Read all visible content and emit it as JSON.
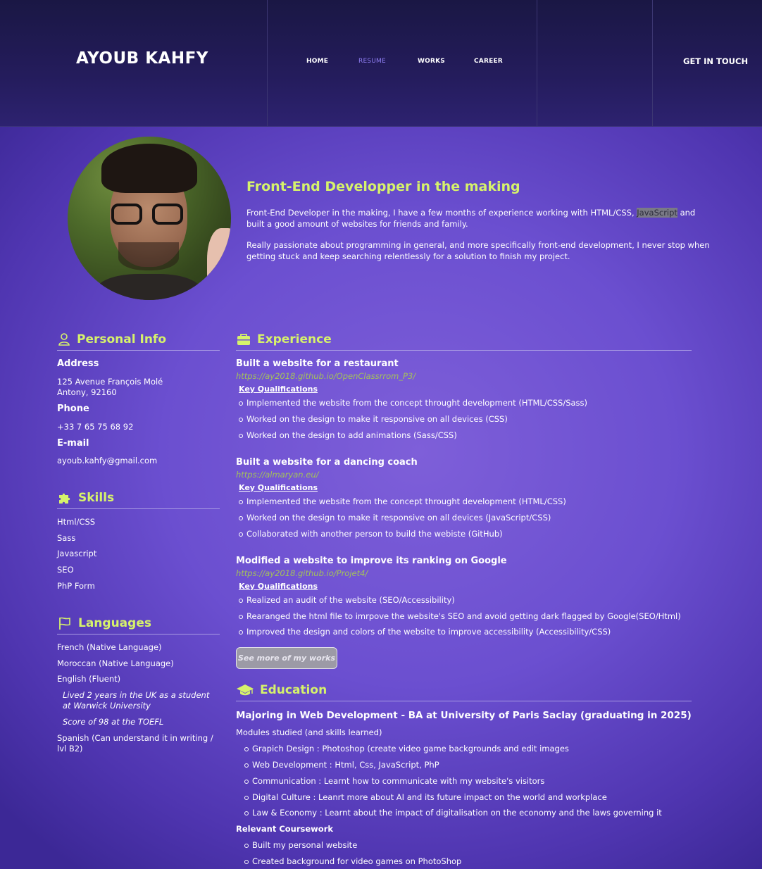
{
  "header": {
    "logo": "AYOUB KAHFY",
    "nav": [
      "HOME",
      "RESUME",
      "WORKS",
      "CAREER"
    ],
    "active_nav": "RESUME",
    "cta": "GET IN TOUCH"
  },
  "hero": {
    "title": "Front-End Developper in the making",
    "p1_before": "Front-End Developer in the making, I have a few months of experience working with HTML/CSS, ",
    "p1_highlight": "JavaScript",
    "p1_after": " and built a good amount of websites for friends and family.",
    "p2": "Really passionate about programming in general, and more specifically front-end development, I never stop when getting stuck and keep searching relentlessly for a solution to finish my project."
  },
  "personal_info": {
    "title": "Personal Info",
    "address_label": "Address",
    "address_line1": "125 Avenue François Molé",
    "address_line2": "Antony, 92160",
    "phone_label": "Phone",
    "phone": "+33 7 65 75 68 92",
    "email_label": "E-mail",
    "email": "ayoub.kahfy@gmail.com"
  },
  "skills": {
    "title": "Skills",
    "items": [
      "Html/CSS",
      "Sass",
      "Javascript",
      "SEO",
      "PhP Form"
    ]
  },
  "languages": {
    "title": "Languages",
    "items": [
      "French (Native Language)",
      "Moroccan (Native Language)",
      "English (Fluent)"
    ],
    "notes": [
      "Lived 2 years in the UK as a student at Warwick University",
      "Score of 98 at the TOEFL"
    ],
    "spanish": "Spanish (Can understand it in writing / lvl B2)"
  },
  "experience": {
    "title": "Experience",
    "key_label": "Key Qualifications",
    "jobs": [
      {
        "title": "Built a website for a restaurant",
        "link": "https://ay2018.github.io/OpenClassrrom_P3/",
        "bullets": [
          "Implemented the website from the concept throught development (HTML/CSS/Sass)",
          "Worked on the design to make it responsive on all devices (CSS)",
          "Worked on the design to add animations (Sass/CSS)"
        ]
      },
      {
        "title": "Built a website for a dancing coach",
        "link": "https://almaryan.eu/",
        "bullets": [
          "Implemented the website from the concept throught development (HTML/CSS)",
          "Worked on the design to make it responsive on all devices (JavaScript/CSS)",
          "Collaborated with another person to build the webiste (GitHub)"
        ]
      },
      {
        "title": "Modified a website to improve its ranking on Google",
        "link": "https://ay2018.github.io/Projet4/",
        "bullets": [
          "Realized an audit of the website (SEO/Accessibility)",
          "Rearanged the html file to imrpove the website's SEO and avoid getting dark flagged by Google(SEO/Html)",
          "Improved the design and colors of the website to improve accessibility (Accessibility/CSS)"
        ]
      }
    ],
    "see_more": "See more of my works"
  },
  "education": {
    "title": "Education",
    "degree": "Majoring in Web Development - BA at University of Paris Saclay (graduating in 2025)",
    "modules_label": "Modules studied (and skills learned)",
    "modules": [
      "Grapich Design : Photoshop (create video game backgrounds and edit images",
      "Web Development : Html, Css, JavaScript, PhP",
      "Communication : Learnt how to communicate with my website's visitors",
      "Digital Culture : Leanrt more about AI and its future impact on the world and workplace",
      "Law & Economy : Learnt about the impact of digitalisation on the economy and the laws governing it"
    ],
    "coursework_label": "Relevant Coursework",
    "coursework": [
      "Built my personal website",
      "Created background for video games on PhotoShop"
    ]
  },
  "colors": {
    "accent": "#d6f26b",
    "link": "#a4c25a",
    "nav_active": "#8f7ef2",
    "header_bg": "#1f1a50"
  }
}
